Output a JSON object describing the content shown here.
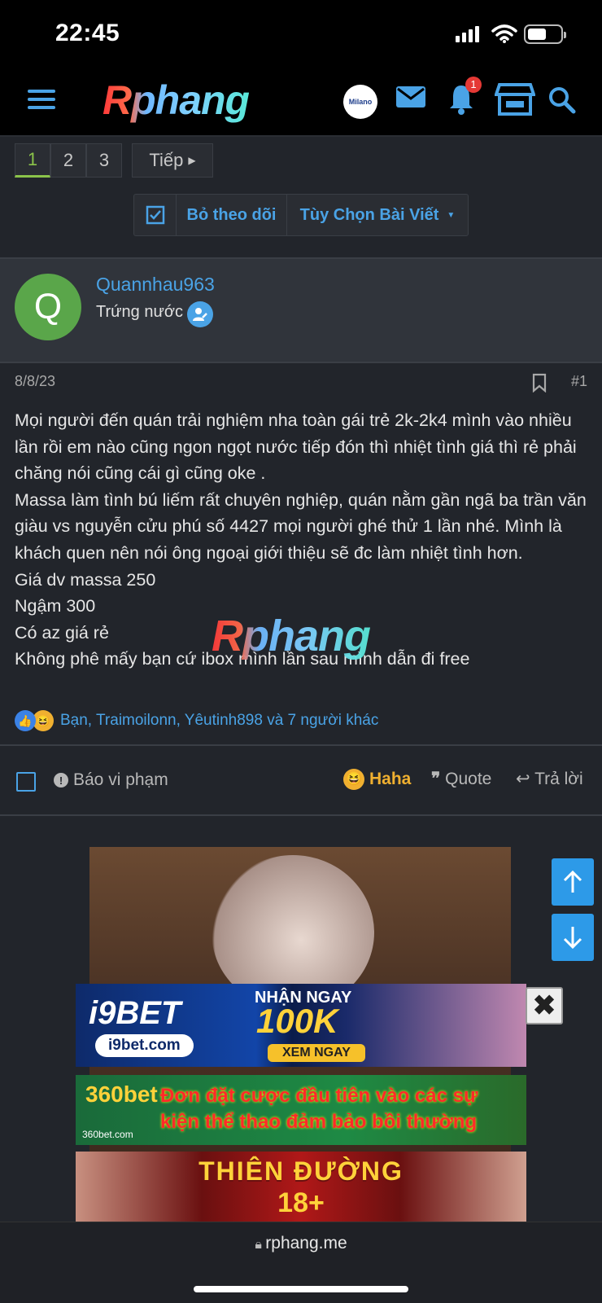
{
  "status": {
    "time": "22:45"
  },
  "nav": {
    "logo": "Rphang",
    "milano_label": "Milano",
    "notification_count": "1"
  },
  "pagination": {
    "pages": [
      "1",
      "2",
      "3"
    ],
    "active": "1",
    "next_label": "Tiếp"
  },
  "thread_actions": {
    "unfollow_label": "Bỏ theo dõi",
    "options_label": "Tùy Chọn Bài Viết"
  },
  "author": {
    "initial": "Q",
    "name": "Quannhau963",
    "rank": "Trứng nước"
  },
  "post": {
    "date": "8/8/23",
    "number": "#1",
    "lines": [
      "Mọi người đến quán trải nghiệm nha toàn gái trẻ 2k-2k4 mình vào nhiều lần rồi em nào cũng ngon ngọt nước tiếp đón thì nhiệt tình giá thì rẻ phải chăng nói cũng cái gì cũng oke .",
      "Massa làm tình bú liếm rất chuyên nghiệp, quán nằm gần ngã ba trần văn giàu vs nguyễn cửu phú số 4427 mọi người ghé thử 1 lần nhé. Mình là khách quen nên nói ông ngoại giới thiệu sẽ đc làm nhiệt tình hơn.",
      "Giá dv massa 250",
      "Ngậm 300",
      "Có az giá rẻ",
      "Không phê mấy bạn cứ ibox mình lần sau mình dẫn đi free"
    ],
    "watermark": "Rphang",
    "reactions_text": "Bạn, Traimoilonn, Yêutinh898 và 7 người khác"
  },
  "post_footer": {
    "report_label": "Báo vi phạm",
    "haha_label": "Haha",
    "quote_label": "Quote",
    "reply_label": "Trả lời"
  },
  "ads": {
    "ad1": {
      "brand": "i9BET",
      "domain": "i9bet.com",
      "line1": "NHẬN NGAY",
      "line2": "100K",
      "cta": "XEM NGAY"
    },
    "ad2": {
      "brand": "360bet",
      "domain": "360bet.com",
      "line1": "Đơn đặt cược đầu tiên vào các sự",
      "line2": "kiện thể thao đảm bảo bồi thường"
    },
    "ad3": {
      "line1": "THIÊN ĐƯỜNG",
      "line2": "18+"
    }
  },
  "browser": {
    "url": "rphang.me"
  },
  "colors": {
    "accent": "#4aa3e6",
    "background": "#22252b",
    "active_page": "#8bc34a",
    "haha": "#f0b030"
  }
}
